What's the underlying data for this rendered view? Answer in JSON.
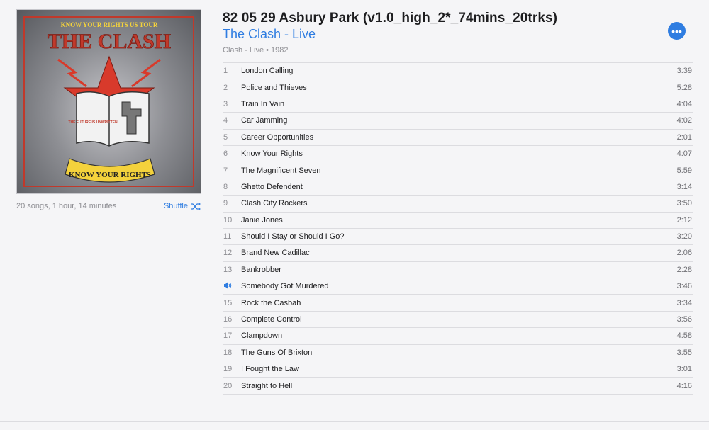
{
  "album": {
    "title": "82 05 29 Asbury Park (v1.0_high_2*_74mins_20trks)",
    "artist_line": "The Clash - Live",
    "info": "Clash - Live • 1982",
    "summary": "20 songs, 1 hour, 14 minutes",
    "shuffle_label": "Shuffle",
    "more_icon": "more-icon",
    "accent_color": "#2f7de1"
  },
  "cover": {
    "top_text": "KNOW YOUR RIGHTS US TOUR",
    "band_text": "THE CLASH",
    "book_text": "THE FUTURE IS UNWRITTEN",
    "banner_text": "KNOW YOUR RIGHTS"
  },
  "tracks": [
    {
      "num": "1",
      "name": "London Calling",
      "dur": "3:39"
    },
    {
      "num": "2",
      "name": "Police and Thieves",
      "dur": "5:28"
    },
    {
      "num": "3",
      "name": "Train In Vain",
      "dur": "4:04"
    },
    {
      "num": "4",
      "name": "Car Jamming",
      "dur": "4:02"
    },
    {
      "num": "5",
      "name": "Career Opportunities",
      "dur": "2:01"
    },
    {
      "num": "6",
      "name": "Know Your Rights",
      "dur": "4:07"
    },
    {
      "num": "7",
      "name": "The Magnificent Seven",
      "dur": "5:59"
    },
    {
      "num": "8",
      "name": "Ghetto Defendent",
      "dur": "3:14"
    },
    {
      "num": "9",
      "name": "Clash City Rockers",
      "dur": "3:50"
    },
    {
      "num": "10",
      "name": "Janie Jones",
      "dur": "2:12"
    },
    {
      "num": "11",
      "name": "Should I Stay or Should I Go?",
      "dur": "3:20"
    },
    {
      "num": "12",
      "name": "Brand New Cadillac",
      "dur": "2:06"
    },
    {
      "num": "13",
      "name": "Bankrobber",
      "dur": "2:28"
    },
    {
      "num": "",
      "name": "Somebody Got Murdered",
      "dur": "3:46",
      "playing": true
    },
    {
      "num": "15",
      "name": "Rock the Casbah",
      "dur": "3:34"
    },
    {
      "num": "16",
      "name": "Complete Control",
      "dur": "3:56"
    },
    {
      "num": "17",
      "name": "Clampdown",
      "dur": "4:58"
    },
    {
      "num": "18",
      "name": "The Guns Of Brixton",
      "dur": "3:55"
    },
    {
      "num": "19",
      "name": "I Fought the Law",
      "dur": "3:01"
    },
    {
      "num": "20",
      "name": "Straight to Hell",
      "dur": "4:16"
    }
  ]
}
